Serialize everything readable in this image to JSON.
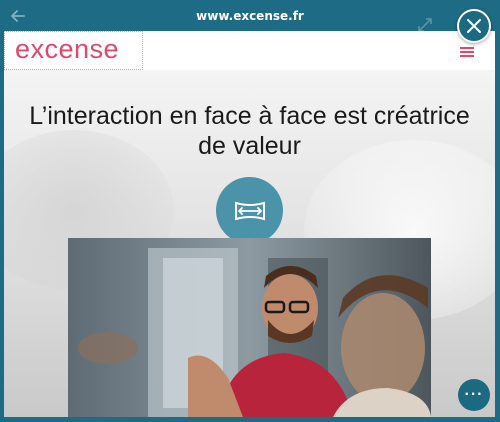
{
  "browser": {
    "url": "www.excense.fr"
  },
  "site": {
    "logo_text": "excense",
    "headline": "L’interaction en face à face est créatrice de valeur"
  },
  "icons": {
    "back": "arrow-left-icon",
    "expand": "expand-icon",
    "close": "close-icon",
    "menu": "hamburger-menu-icon",
    "feature": "stretch-arrows-icon",
    "more": "more-dots-icon"
  },
  "fab": {
    "label": "···"
  },
  "colors": {
    "frame": "#1d6b84",
    "brand": "#e2476c",
    "feature_circle": "#4a93a8"
  }
}
